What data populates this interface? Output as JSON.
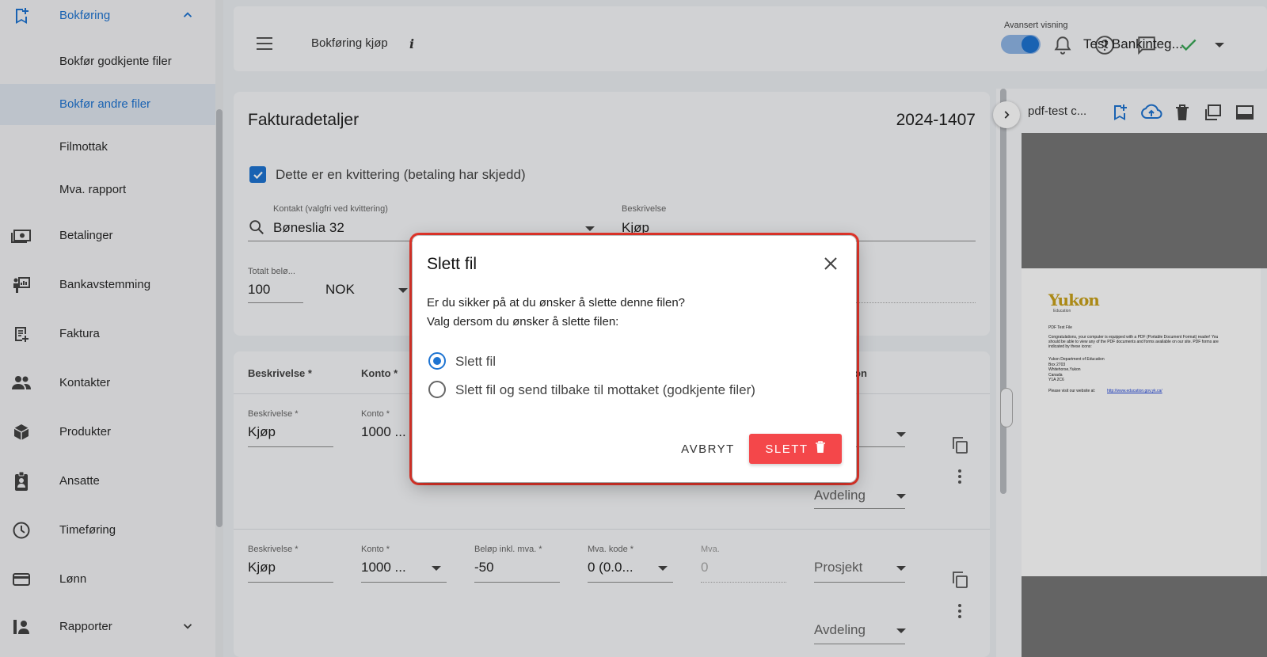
{
  "sidebar": {
    "items": [
      {
        "label": "Bokføring"
      },
      {
        "label": "Bokfør godkjente filer"
      },
      {
        "label": "Bokfør andre filer"
      },
      {
        "label": "Filmottak"
      },
      {
        "label": "Mva. rapport"
      },
      {
        "label": "Betalinger"
      },
      {
        "label": "Bankavstemming"
      },
      {
        "label": "Faktura"
      },
      {
        "label": "Kontakter"
      },
      {
        "label": "Produkter"
      },
      {
        "label": "Ansatte"
      },
      {
        "label": "Timeføring"
      },
      {
        "label": "Lønn"
      },
      {
        "label": "Rapporter"
      }
    ],
    "active_color": "#1e74d2"
  },
  "header": {
    "title": "Bokføring kjøp",
    "info": "i",
    "advanced_label": "Avansert visning",
    "company": "Test Bankinteg..."
  },
  "invoice": {
    "title": "Fakturadetaljer",
    "number": "2024-1407",
    "receipt_label": "Dette er en kvittering (betaling har skjedd)",
    "contact_label": "Kontakt (valgfri ved kvittering)",
    "contact_value": "Bøneslia 32",
    "description_label": "Beskrivelse",
    "description_value": "Kjøp",
    "total_label": "Totalt belø...",
    "total_value": "100",
    "currency": "NOK"
  },
  "lines": {
    "headers": [
      "Beskrivelse *",
      "Konto *",
      "on"
    ],
    "rows": [
      {
        "desc_label": "Beskrivelse *",
        "desc": "Kjøp",
        "acct_label": "Konto *",
        "acct": "1000 ...",
        "dept": "Avdeling"
      },
      {
        "desc_label": "Beskrivelse *",
        "desc": "Kjøp",
        "acct_label": "Konto *",
        "acct": "1000 ...",
        "amount_label": "Beløp inkl. mva. *",
        "amount": "-50",
        "vat_label": "Mva. kode *",
        "vat": "0 (0.0...",
        "mva_label": "Mva.",
        "mva": "0",
        "project": "Prosjekt",
        "dept": "Avdeling"
      }
    ]
  },
  "preview": {
    "filename": "pdf-test c...",
    "logo": "Yukon",
    "logo_sub": "Education",
    "doc_title": "PDF Test File",
    "doc_body": "Congratulations, your computer is equipped with a PDF (Portable Document Format) reader! You should be able to view any of the PDF documents and forms available on our site. PDF forms are indicated by these icons:",
    "address": [
      "Yukon Department of Education",
      "Box 2703",
      "Whitehorse,Yukon",
      "Canada",
      "Y1A 2C6"
    ],
    "visit_text": "Please visit our website at:",
    "link": "http://www.education.gov.yk.ca/"
  },
  "dialog": {
    "title": "Slett fil",
    "question": "Er du sikker på at du ønsker å slette denne filen?",
    "instruction": "Valg dersom du ønsker å slette filen:",
    "options": [
      "Slett fil",
      "Slett fil og send tilbake til mottaket (godkjente filer)"
    ],
    "selected": 0,
    "cancel": "AVBRYT",
    "confirm": "SLETT",
    "confirm_color": "#f4474a",
    "outline_color": "#e8362b"
  }
}
